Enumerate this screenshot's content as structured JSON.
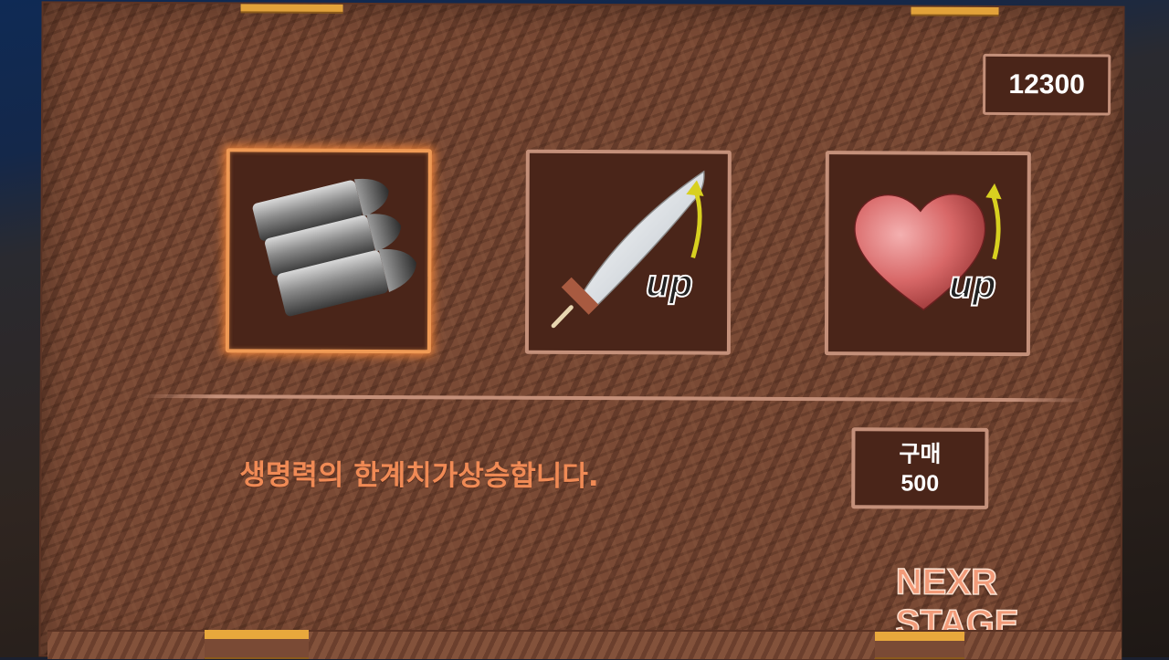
{
  "currency": {
    "amount": "12300"
  },
  "shop": {
    "items": [
      {
        "icon": "bullets-icon",
        "selected": true,
        "badge": ""
      },
      {
        "icon": "sword-upgrade-icon",
        "selected": false,
        "badge": "up"
      },
      {
        "icon": "heart-upgrade-icon",
        "selected": false,
        "badge": "up"
      }
    ],
    "description": "생명력의 한계치가상승합니다."
  },
  "buy_button": {
    "label": "구매",
    "price": "500"
  },
  "next_stage": {
    "label": "NEXR STAGE"
  },
  "colors": {
    "board": "#7a4a35",
    "slot_bg": "#4a2519",
    "slot_border": "#c4907a",
    "selected_glow": "#f09a55",
    "description_text": "#f08a55",
    "clip": "#e2a23a"
  }
}
